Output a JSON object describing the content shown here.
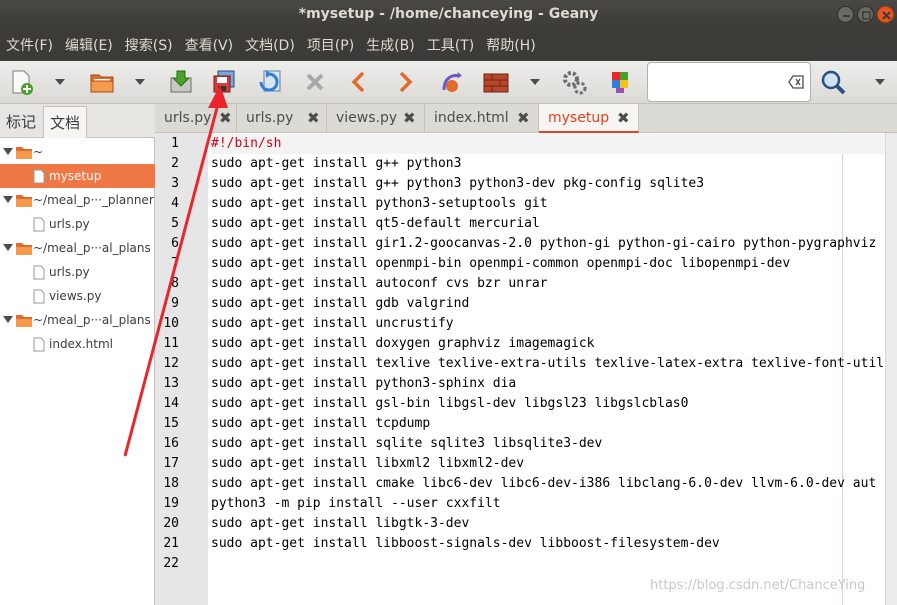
{
  "window": {
    "title": "*mysetup - /home/chanceying - Geany"
  },
  "menu": [
    "文件(F)",
    "编辑(E)",
    "搜索(S)",
    "查看(V)",
    "文档(D)",
    "项目(P)",
    "生成(B)",
    "工具(T)",
    "帮助(H)"
  ],
  "toolbar": {
    "icons": [
      "new-file-icon",
      "dropdown-arrow-icon",
      "open-folder-icon",
      "dropdown-arrow-icon",
      "save-icon",
      "save-all-icon",
      "revert-icon",
      "close-file-icon",
      "back-icon",
      "forward-icon",
      "compile-icon",
      "build-icon",
      "dropdown-arrow-icon",
      "execute-icon",
      "color-chooser-icon"
    ],
    "search": {
      "value": "",
      "placeholder": ""
    }
  },
  "sidebar": {
    "tabs": [
      "标记",
      "文档"
    ],
    "active_tab": "文档",
    "tree": [
      {
        "type": "folder",
        "label": "~"
      },
      {
        "type": "file",
        "label": "mysetup",
        "selected": true
      },
      {
        "type": "folder",
        "label": "~/meal_p···_planner"
      },
      {
        "type": "file",
        "label": "urls.py"
      },
      {
        "type": "folder",
        "label": "~/meal_p···al_plans"
      },
      {
        "type": "file",
        "label": "urls.py"
      },
      {
        "type": "file",
        "label": "views.py"
      },
      {
        "type": "folder",
        "label": "~/meal_p···al_plans"
      },
      {
        "type": "file",
        "label": "index.html"
      }
    ]
  },
  "editor_tabs": [
    {
      "label": "urls.py",
      "active": false
    },
    {
      "label": "urls.py",
      "active": false
    },
    {
      "label": "views.py",
      "active": false
    },
    {
      "label": "index.html",
      "active": false
    },
    {
      "label": "mysetup",
      "active": true
    }
  ],
  "code": {
    "line_numbers": [
      "1",
      "2",
      "3",
      "4",
      "5",
      "6",
      "7",
      "8",
      "9",
      "10",
      "11",
      "12",
      "13",
      "14",
      "15",
      "16",
      "17",
      "18",
      "19",
      "20",
      "21",
      "22"
    ],
    "lines": [
      "#!/bin/sh",
      "sudo apt-get install g++ python3",
      "sudo apt-get install g++ python3 python3-dev pkg-config sqlite3",
      "sudo apt-get install python3-setuptools git",
      "sudo apt-get install qt5-default mercurial",
      "sudo apt-get install gir1.2-goocanvas-2.0 python-gi python-gi-cairo python-pygraphviz",
      "sudo apt-get install openmpi-bin openmpi-common openmpi-doc libopenmpi-dev",
      "sudo apt-get install autoconf cvs bzr unrar",
      "sudo apt-get install gdb valgrind",
      "sudo apt-get install uncrustify",
      "sudo apt-get install doxygen graphviz imagemagick",
      "sudo apt-get install texlive texlive-extra-utils texlive-latex-extra texlive-font-utils",
      "sudo apt-get install python3-sphinx dia",
      "sudo apt-get install gsl-bin libgsl-dev libgsl23 libgslcblas0",
      "sudo apt-get install tcpdump",
      "sudo apt-get install sqlite sqlite3 libsqlite3-dev",
      "sudo apt-get install libxml2 libxml2-dev",
      "sudo apt-get install cmake libc6-dev libc6-dev-i386 libclang-6.0-dev llvm-6.0-dev aut",
      "python3 -m pip install --user cxxfilt",
      "sudo apt-get install libgtk-3-dev",
      "sudo apt-get install libboost-signals-dev libboost-filesystem-dev",
      ""
    ]
  },
  "watermark": "https://blog.csdn.net/ChanceYing",
  "colors": {
    "accent": "#f07746",
    "active_tab": "#e2421b",
    "annotation": "#e8262c"
  }
}
